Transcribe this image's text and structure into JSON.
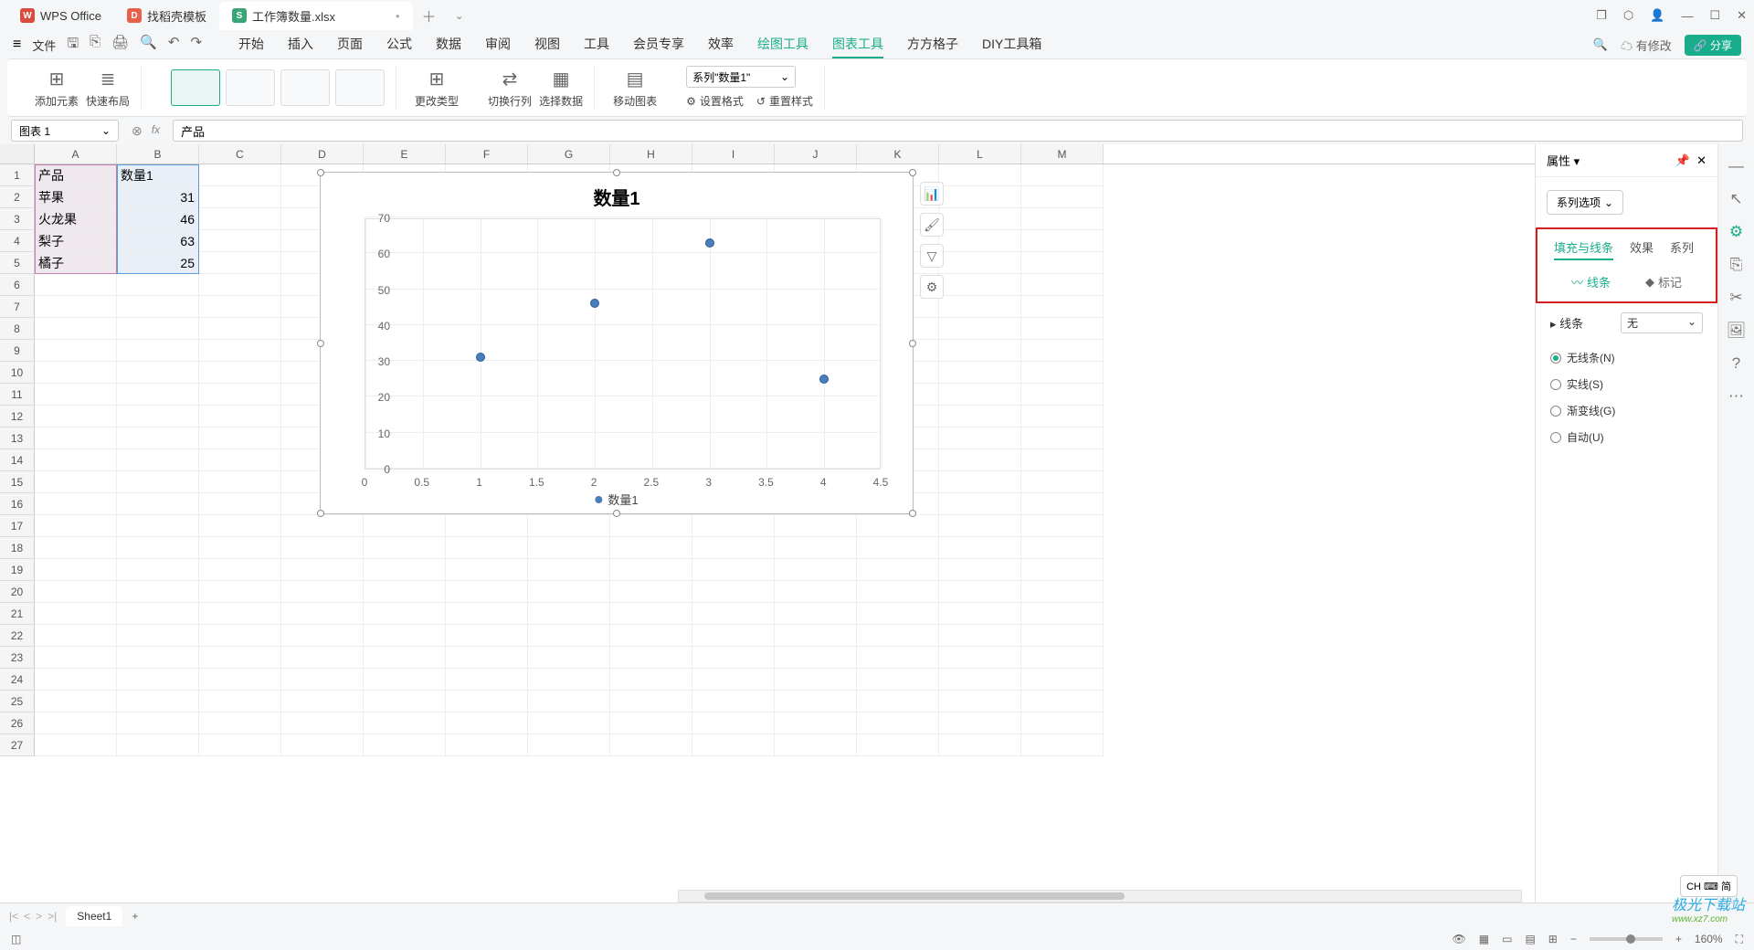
{
  "titlebar": {
    "tabs": [
      {
        "label": "WPS Office",
        "icon": "W"
      },
      {
        "label": "找稻壳模板",
        "icon": "D"
      },
      {
        "label": "工作簿数量.xlsx",
        "icon": "S"
      }
    ]
  },
  "menubar": {
    "file": "文件",
    "tabs": [
      "开始",
      "插入",
      "页面",
      "公式",
      "数据",
      "审阅",
      "视图",
      "工具",
      "会员专享",
      "效率",
      "绘图工具",
      "图表工具",
      "方方格子",
      "DIY工具箱"
    ],
    "active_index": 11,
    "green_index": 10,
    "modify": "有修改",
    "share": "分享"
  },
  "ribbon": {
    "addElement": "添加元素",
    "quickLayout": "快速布局",
    "changeType": "更改类型",
    "switchRowCol": "切换行列",
    "selectData": "选择数据",
    "moveChart": "移动图表",
    "seriesSelect": "系列\"数量1\"",
    "setFormat": "设置格式",
    "resetStyle": "重置样式"
  },
  "fbar": {
    "name": "图表 1",
    "formula": "产品"
  },
  "columns": [
    "A",
    "B",
    "C",
    "D",
    "E",
    "F",
    "G",
    "H",
    "I",
    "J",
    "K",
    "L",
    "M"
  ],
  "row_count": 27,
  "table": {
    "header": [
      "产品",
      "数量1"
    ],
    "rows": [
      [
        "苹果",
        31
      ],
      [
        "火龙果",
        46
      ],
      [
        "梨子",
        63
      ],
      [
        "橘子",
        25
      ]
    ]
  },
  "chart_data": {
    "type": "scatter",
    "title": "数量1",
    "x": [
      1,
      2,
      3,
      4
    ],
    "values": [
      31,
      46,
      63,
      25
    ],
    "x_ticks": [
      0,
      0.5,
      1,
      1.5,
      2,
      2.5,
      3,
      3.5,
      4,
      4.5
    ],
    "y_ticks": [
      0,
      10,
      20,
      30,
      40,
      50,
      60,
      70
    ],
    "xlim": [
      0,
      4.5
    ],
    "ylim": [
      0,
      70
    ],
    "legend": "数量1"
  },
  "prop": {
    "title": "属性",
    "dropdown": "系列选项",
    "tabs": [
      "填充与线条",
      "效果",
      "系列"
    ],
    "active_tab": 0,
    "subtabs": [
      "线条",
      "标记"
    ],
    "lineLabel": "线条",
    "lineValue": "无",
    "radios": [
      "无线条(N)",
      "实线(S)",
      "渐变线(G)",
      "自动(U)"
    ],
    "radio_checked": 0
  },
  "sheet": {
    "name": "Sheet1"
  },
  "status": {
    "zoom": "160%",
    "ime": "CH ⌨ 简"
  },
  "watermark": {
    "line1": "极光下载站",
    "line2": "www.xz7.com"
  }
}
